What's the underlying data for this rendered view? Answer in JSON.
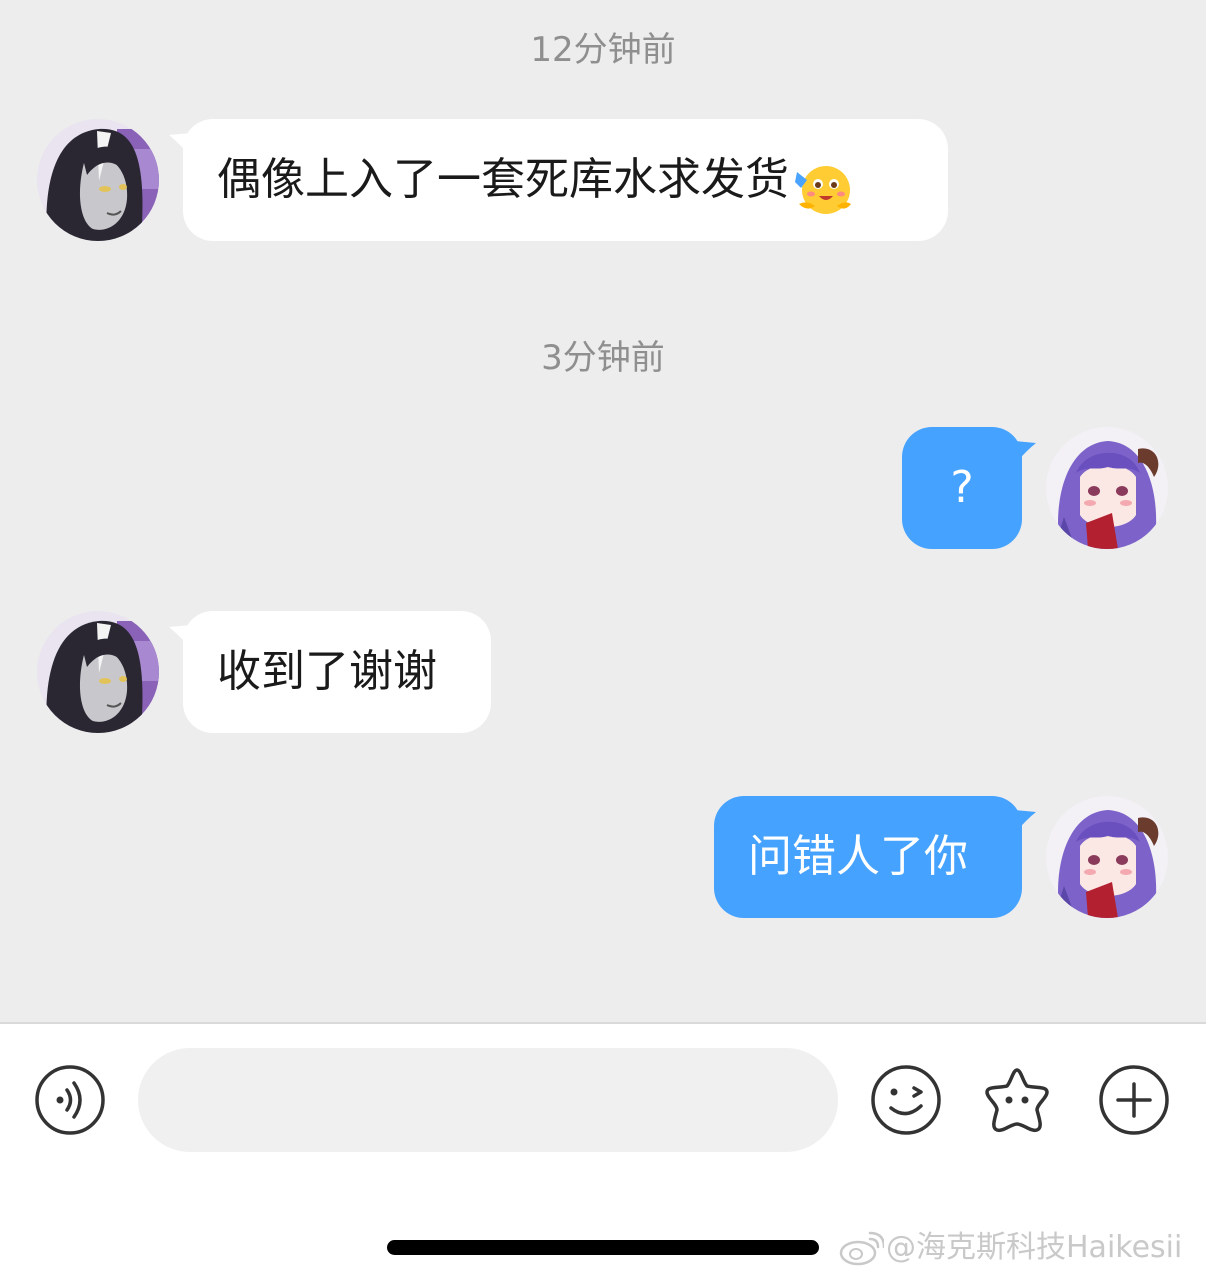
{
  "messages": [
    {
      "type": "timestamp",
      "text": "12分钟前"
    },
    {
      "type": "incoming",
      "text": "偶像上入了一套死库水求发货",
      "emoji": "hugging-face-emoji"
    },
    {
      "type": "timestamp",
      "text": "3分钟前"
    },
    {
      "type": "outgoing",
      "text": "?"
    },
    {
      "type": "incoming",
      "text": "收到了谢谢"
    },
    {
      "type": "outgoing",
      "text": "问错人了你"
    }
  ],
  "input_bar": {
    "voice_icon": "voice-icon",
    "text_value": "",
    "emoji_icon": "smiley-icon",
    "sticker_icon": "star-sticker-icon",
    "more_icon": "plus-icon"
  },
  "watermark": "@海克斯科技Haikesii",
  "colors": {
    "background": "#ededed",
    "outgoing_bubble": "#45a3ff",
    "incoming_bubble": "#ffffff",
    "timestamp": "#8f8f8f"
  }
}
